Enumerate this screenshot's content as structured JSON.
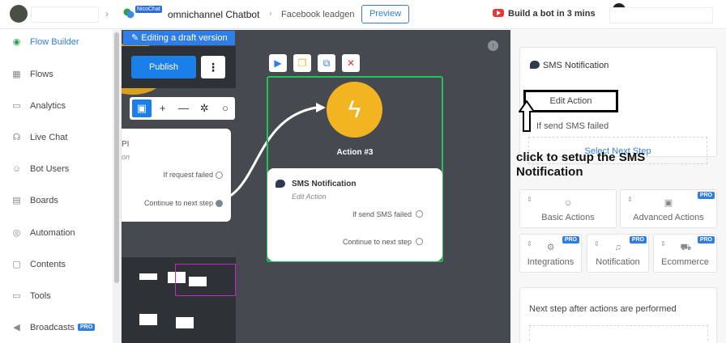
{
  "topbar": {
    "bot_badge": "NicoChat",
    "bot_name": "omnichannel Chatbot",
    "flow_name": "Facebook leadgen",
    "preview_label": "Preview",
    "build_link": "Build a bot in 3 mins"
  },
  "sidebar": {
    "items": [
      {
        "label": "Flow Builder",
        "icon": "flow-builder-icon",
        "glyph": "◉"
      },
      {
        "label": "Flows",
        "icon": "flows-icon",
        "glyph": "▦"
      },
      {
        "label": "Analytics",
        "icon": "analytics-icon",
        "glyph": "▭"
      },
      {
        "label": "Live Chat",
        "icon": "headset-icon",
        "glyph": "☊"
      },
      {
        "label": "Bot Users",
        "icon": "user-icon",
        "glyph": "☺"
      },
      {
        "label": "Boards",
        "icon": "boards-icon",
        "glyph": "▤"
      },
      {
        "label": "Automation",
        "icon": "automation-icon",
        "glyph": "◎"
      },
      {
        "label": "Contents",
        "icon": "contents-icon",
        "glyph": "▢"
      },
      {
        "label": "Tools",
        "icon": "tools-icon",
        "glyph": "▭"
      },
      {
        "label": "Broadcasts",
        "icon": "broadcast-icon",
        "glyph": "◀",
        "badge": "PRO"
      }
    ]
  },
  "canvas": {
    "draft_label": "Editing a draft version",
    "publish_label": "Publish",
    "kebab_glyph": "⋮",
    "tools": [
      "▣",
      "+",
      "—",
      "✲",
      "○"
    ],
    "left_card": {
      "frag1": "PI",
      "frag2": "on",
      "port1": "If request failed",
      "port2": "Continue to next step"
    },
    "node_tools": [
      "▶",
      "❐",
      "⧉",
      "✕"
    ],
    "action_title": "Action #3",
    "bolt_glyph": "ϟ",
    "sms_card": {
      "title": "SMS Notification",
      "subtitle": "Edit Action",
      "port1": "If send SMS failed",
      "port2": "Continue to next step"
    }
  },
  "right_panel": {
    "header": "SMS Notification",
    "edit_action": "Edit Action",
    "fail_text": "If send SMS failed",
    "select_next": "Select Next Step",
    "annotation": "click to setup the SMS Notification",
    "actions": [
      {
        "label": "Basic Actions",
        "glyph": "☺",
        "pro": ""
      },
      {
        "label": "Advanced Actions",
        "glyph": "▣",
        "pro": "PRO"
      },
      {
        "label": "Integrations",
        "glyph": "⚙",
        "pro": "PRO"
      },
      {
        "label": "Notification",
        "glyph": "♫",
        "pro": "PRO"
      },
      {
        "label": "Ecommerce",
        "glyph": "⛟",
        "pro": "PRO"
      }
    ],
    "next_step_label": "Next step after actions are performed"
  }
}
